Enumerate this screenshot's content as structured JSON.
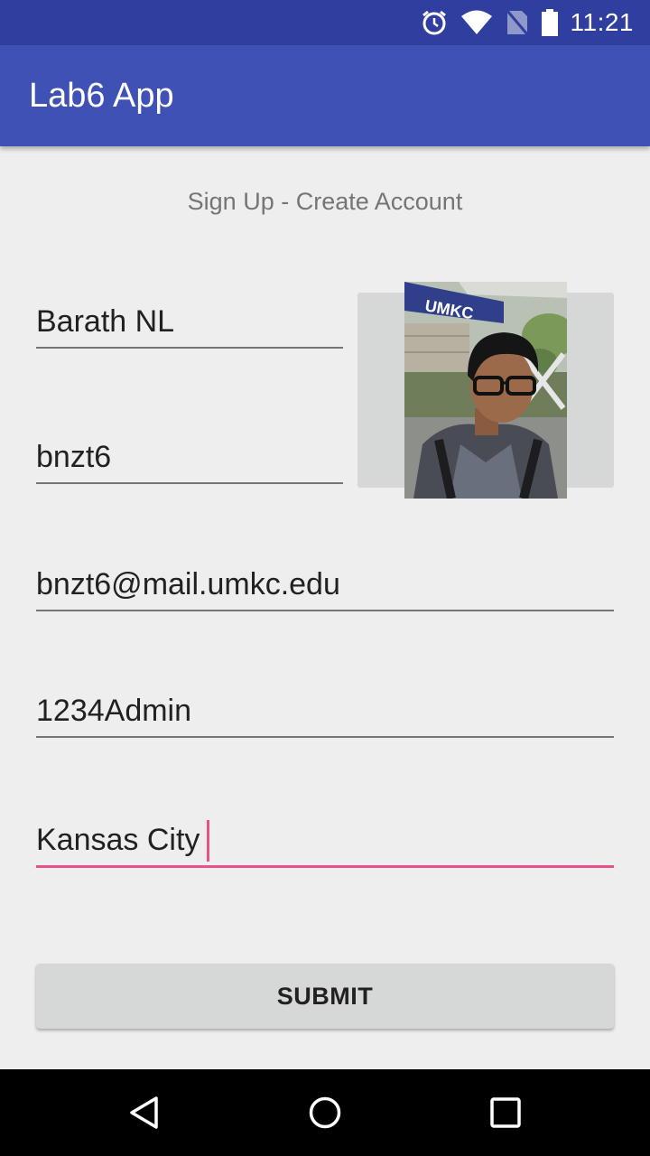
{
  "status_bar": {
    "time": "11:21",
    "icons": [
      "alarm-icon",
      "wifi-icon",
      "no-signal-icon",
      "battery-icon"
    ]
  },
  "app_bar": {
    "title": "Lab6 App",
    "color": "#3f51b5"
  },
  "form": {
    "heading": "Sign Up - Create Account",
    "fields": [
      {
        "name": "name",
        "value": "Barath NL"
      },
      {
        "name": "username",
        "value": "bnzt6"
      },
      {
        "name": "email",
        "value": "bnzt6@mail.umkc.edu"
      },
      {
        "name": "password",
        "value": "1234Admin"
      },
      {
        "name": "city",
        "value": "Kansas City"
      }
    ],
    "photo_sign_text": "UMKC",
    "submit_label": "SUBMIT",
    "accent_color": "#e8528a"
  },
  "nav_bar": {
    "icons": [
      "back-icon",
      "home-icon",
      "recents-icon"
    ]
  }
}
